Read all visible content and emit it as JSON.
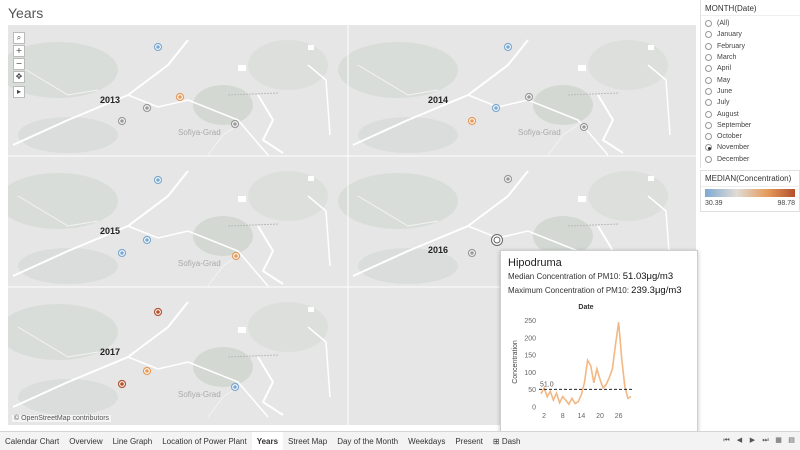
{
  "title": "Years",
  "map": {
    "attribution": "© OpenStreetMap contributors",
    "city_label": "Sofiya-Grad",
    "controls": [
      {
        "name": "search-icon",
        "glyph": "⌕"
      },
      {
        "name": "zoom-in-icon",
        "glyph": "+"
      },
      {
        "name": "zoom-out-icon",
        "glyph": "−"
      },
      {
        "name": "pan-icon",
        "glyph": "✥"
      },
      {
        "name": "expand-icon",
        "glyph": "▸"
      }
    ],
    "panels": [
      {
        "year": "2013"
      },
      {
        "year": "2014"
      },
      {
        "year": "2015"
      },
      {
        "year": "2016"
      },
      {
        "year": "2017"
      }
    ]
  },
  "filter": {
    "title": "MONTH(Date)",
    "options": [
      "(All)",
      "January",
      "February",
      "March",
      "April",
      "May",
      "June",
      "July",
      "August",
      "September",
      "October",
      "November",
      "December"
    ],
    "selected": "November"
  },
  "legend": {
    "title": "MEDIAN(Concentration)",
    "min": "30.39",
    "max": "98.78",
    "color_low": "#7da9d1",
    "color_high": "#b3512d"
  },
  "tooltip": {
    "name": "Hipodruma",
    "median_label": "Median Concentration of PM10:",
    "median_value": "51.03μg/m3",
    "max_label": "Maximum Concentration of PM10:",
    "max_value": "239.3μg/m3"
  },
  "chart_data": {
    "type": "line",
    "title": "Date",
    "xlabel": "",
    "ylabel": "Concentration",
    "x": [
      1,
      2,
      3,
      4,
      5,
      6,
      7,
      8,
      9,
      10,
      11,
      12,
      13,
      14,
      15,
      16,
      17,
      18,
      19,
      20,
      21,
      22,
      23,
      24,
      25,
      26,
      27,
      28,
      29,
      30
    ],
    "values": [
      38,
      55,
      30,
      45,
      20,
      40,
      12,
      30,
      20,
      8,
      25,
      10,
      15,
      35,
      70,
      135,
      120,
      70,
      110,
      80,
      55,
      65,
      85,
      110,
      180,
      245,
      140,
      60,
      25,
      30
    ],
    "xticks": [
      "2",
      "8",
      "14",
      "20",
      "26"
    ],
    "yticks": [
      0,
      50,
      100,
      150,
      200,
      250
    ],
    "ylim": [
      0,
      260
    ],
    "reference_line": {
      "value": 51.0,
      "label": "51.0"
    },
    "series_color": "#f3b783"
  },
  "tabs": [
    "Calendar Chart",
    "Overview",
    "Line Graph",
    "Location of Power Plant",
    "Years",
    "Street Map",
    "Day of the Month",
    "Weekdays",
    "Present",
    "Dash"
  ],
  "active_tab": "Years",
  "colors": {
    "blue_marker": "#7da9d1",
    "orange_marker": "#e59a5a",
    "red_marker": "#b3512d",
    "gray_marker": "#9a9a9a"
  }
}
